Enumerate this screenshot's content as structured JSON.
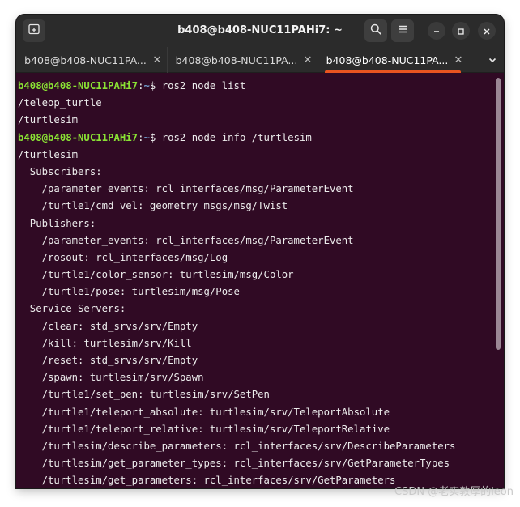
{
  "window": {
    "title": "b408@b408-NUC11PAHi7: ~"
  },
  "tabs": [
    {
      "label": "b408@b408-NUC11PA...",
      "close": "✕",
      "active": false
    },
    {
      "label": "b408@b408-NUC11PA...",
      "close": "✕",
      "active": false
    },
    {
      "label": "b408@b408-NUC11PA...",
      "close": "✕",
      "active": true
    }
  ],
  "colors": {
    "terminal_bg": "#300a24",
    "prompt_user": "#8ae234",
    "prompt_path": "#729fcf",
    "active_tab_accent": "#e95420"
  },
  "icons": {
    "new_tab": "new-tab-icon",
    "search": "search-icon",
    "menu": "hamburger-menu-icon",
    "minimize": "minimize-icon",
    "maximize": "maximize-icon",
    "close": "close-icon",
    "tab_list": "chevron-down-icon"
  },
  "terminal": {
    "prompt_user": "b408@b408-NUC11PAHi7",
    "prompt_colon": ":",
    "prompt_path": "~",
    "prompt_symbol": "$ ",
    "command1": "ros2 node list",
    "output1": [
      "/teleop_turtle",
      "/turtlesim"
    ],
    "command2": "ros2 node info /turtlesim",
    "output2": [
      "/turtlesim",
      "  Subscribers:",
      "    /parameter_events: rcl_interfaces/msg/ParameterEvent",
      "    /turtle1/cmd_vel: geometry_msgs/msg/Twist",
      "  Publishers:",
      "    /parameter_events: rcl_interfaces/msg/ParameterEvent",
      "    /rosout: rcl_interfaces/msg/Log",
      "    /turtle1/color_sensor: turtlesim/msg/Color",
      "    /turtle1/pose: turtlesim/msg/Pose",
      "  Service Servers:",
      "    /clear: std_srvs/srv/Empty",
      "    /kill: turtlesim/srv/Kill",
      "    /reset: std_srvs/srv/Empty",
      "    /spawn: turtlesim/srv/Spawn",
      "    /turtle1/set_pen: turtlesim/srv/SetPen",
      "    /turtle1/teleport_absolute: turtlesim/srv/TeleportAbsolute",
      "    /turtle1/teleport_relative: turtlesim/srv/TeleportRelative",
      "    /turtlesim/describe_parameters: rcl_interfaces/srv/DescribeParameters",
      "    /turtlesim/get_parameter_types: rcl_interfaces/srv/GetParameterTypes",
      "    /turtlesim/get_parameters: rcl_interfaces/srv/GetParameters"
    ]
  },
  "watermark": "CSDN @老实敦厚的leon"
}
